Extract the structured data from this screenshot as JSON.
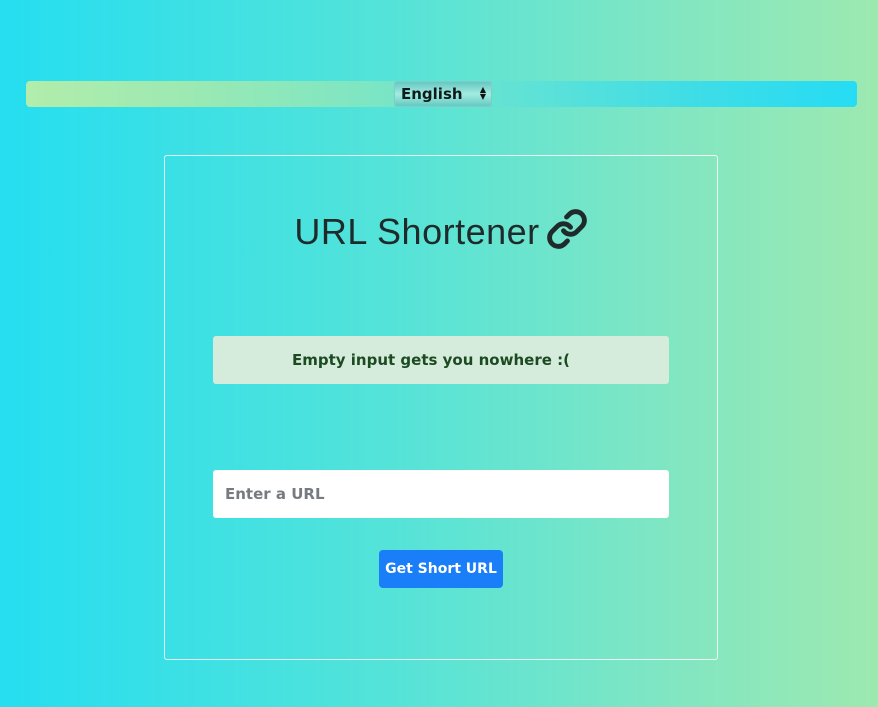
{
  "language_selector": {
    "selected": "English",
    "icon": "up-down-arrows-icon"
  },
  "card": {
    "title": "URL Shortener",
    "title_icon": "link-icon",
    "alert_message": "Empty input gets you nowhere :(",
    "url_input": {
      "value": "",
      "placeholder": "Enter a URL"
    },
    "submit_label": "Get Short URL"
  },
  "colors": {
    "primary_button": "#1a7ef8",
    "alert_background": "#d5ebdb",
    "alert_text": "#1c4b22",
    "title_text": "#1f2a2b"
  }
}
